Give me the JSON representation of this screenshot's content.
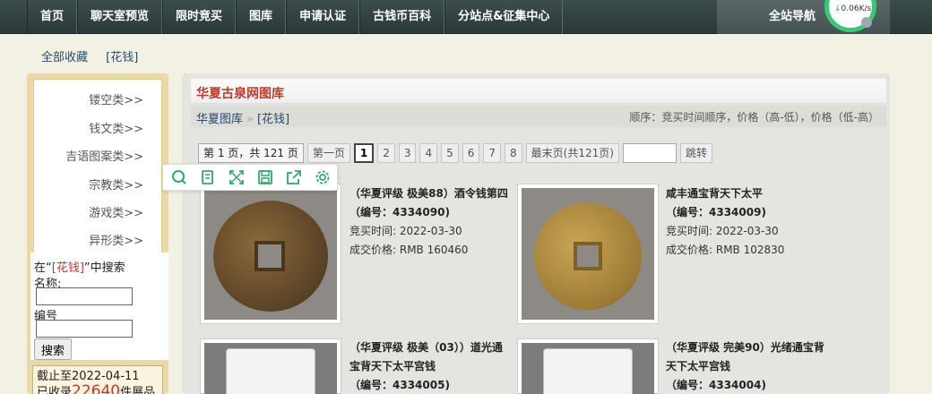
{
  "topnav": {
    "items": [
      "首页",
      "聊天室预览",
      "限时竞买",
      "图库",
      "申请认证",
      "古钱币百科",
      "分站点&征集中心"
    ],
    "site_nav": "全站导航",
    "speed_value": "0.06K/s",
    "speed_arrow": "↓"
  },
  "crumbs": [
    "全部收藏",
    "[花钱]"
  ],
  "sidebar": {
    "categories": [
      "镂空类>>",
      "钱文类>>",
      "吉语图案类>>",
      "宗教类>>",
      "游戏类>>",
      "异形类>>"
    ],
    "search_prefix": "在“",
    "search_keyword": "[花钱]",
    "search_suffix": "”中搜索",
    "name_label": "名称:",
    "code_label": "编号",
    "search_button": "搜索",
    "stats_line1": "截止至2022-04-11",
    "stats_prefix": "已收录",
    "stats_count": "22640",
    "stats_suffix": "件展品"
  },
  "main": {
    "title": "华夏古泉网图库",
    "path_root": "华夏图库",
    "path_sep": "»",
    "path_cat": "[花钱]",
    "sort_text": "顺序：竞买时间顺序，价格（高-低），价格（低-高）",
    "pager": {
      "info": "第 1 页，共 121 页",
      "first": "第一页",
      "pages": [
        "1",
        "2",
        "3",
        "4",
        "5",
        "6",
        "7",
        "8"
      ],
      "last": "最末页(共121页)",
      "jump": "跳转"
    }
  },
  "toolbar_icons": [
    "search-icon",
    "copy-icon",
    "fullscreen-icon",
    "save-icon",
    "share-icon",
    "settings-icon"
  ],
  "items": [
    {
      "name1": "（华夏评级 极美88）酒令钱第四",
      "name2": "（编号：4334090)",
      "time": "竞买时间: 2022-03-30",
      "price": "成交价格: RMB 160460"
    },
    {
      "name1": "咸丰通宝背天下太平",
      "name2": "（编号：4334009)",
      "time": "竞买时间: 2022-03-30",
      "price": "成交价格: RMB 102830"
    },
    {
      "name1": "（华夏评级 极美（03））道光通",
      "name2": "宝背天下太平宫钱",
      "name3": "（编号：4334005)"
    },
    {
      "name1": "（华夏评级 完美90）光绪通宝背",
      "name2": "天下太平宫钱",
      "name3": "（编号：4334004)"
    }
  ],
  "colors": {
    "accent_red": "#c0392b",
    "nav_bg": "#2f3d3d",
    "link_blue": "#2c4a6b",
    "toolbar_green": "#2eaa6e"
  }
}
